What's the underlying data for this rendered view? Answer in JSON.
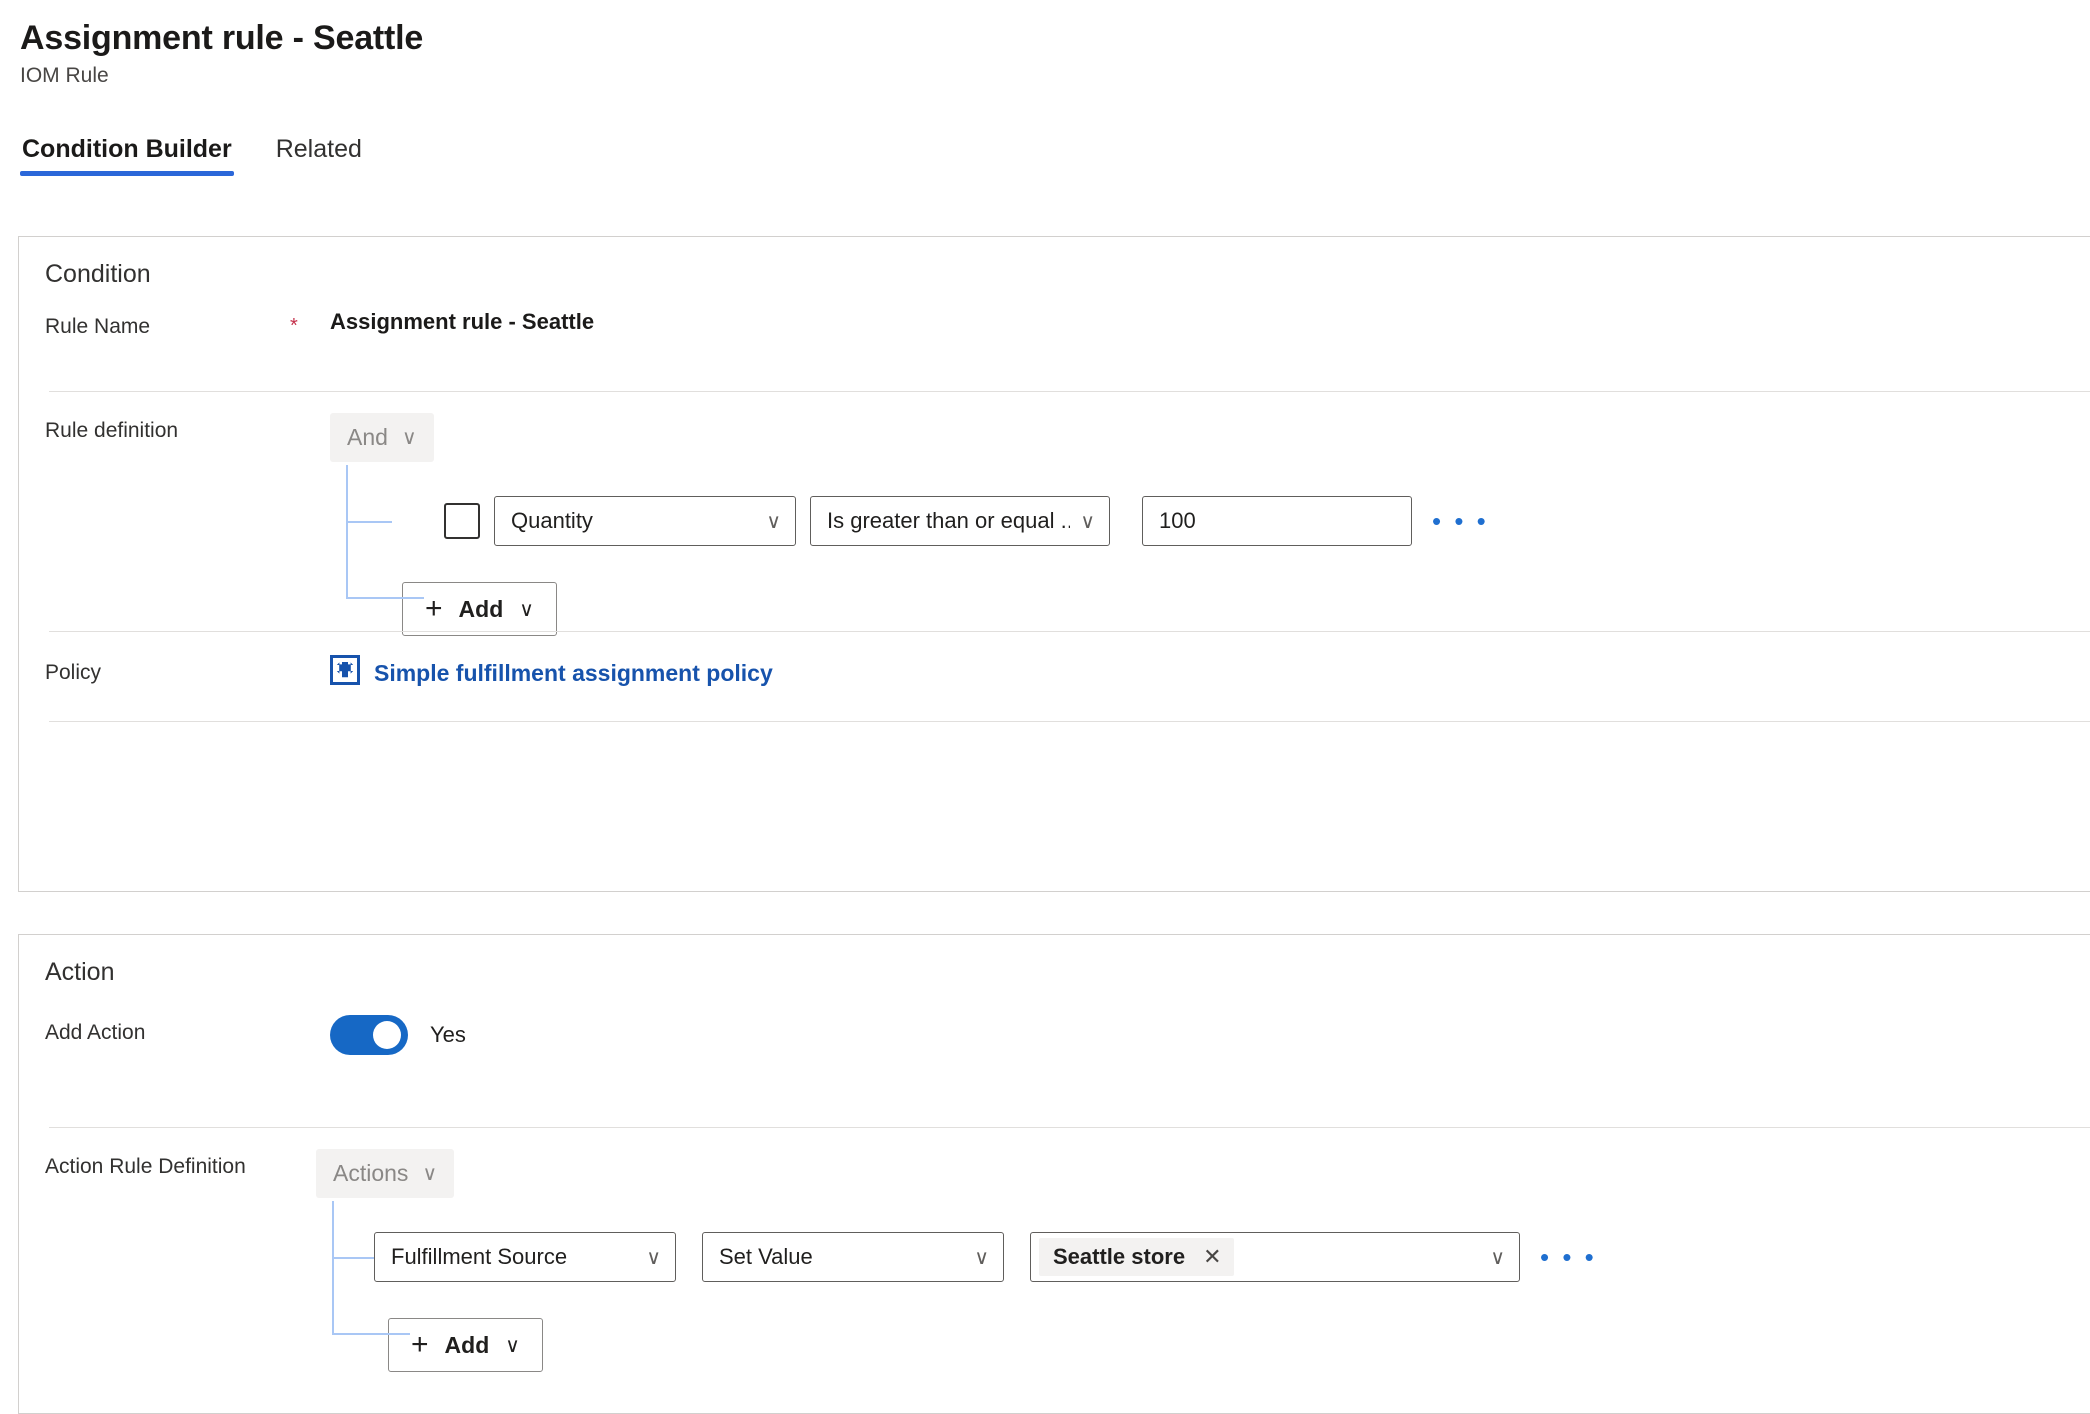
{
  "header": {
    "title": "Assignment rule - Seattle",
    "subtitle": "IOM Rule"
  },
  "tabs": [
    {
      "label": "Condition Builder",
      "selected": true
    },
    {
      "label": "Related",
      "selected": false
    }
  ],
  "condition": {
    "section_title": "Condition",
    "rule_name": {
      "label": "Rule Name",
      "required_marker": "*",
      "value": "Assignment rule - Seattle"
    },
    "rule_definition": {
      "label": "Rule definition",
      "group_operator": "And",
      "clause": {
        "attribute": "Quantity",
        "operator": "Is greater than or equal ...",
        "value": "100",
        "overflow_label": "• • •"
      },
      "add_label": "Add",
      "add_plus": "+"
    },
    "policy": {
      "label": "Policy",
      "link_text": "Simple fulfillment assignment policy"
    }
  },
  "action": {
    "section_title": "Action",
    "add_action": {
      "label": "Add Action",
      "toggle_state": "Yes"
    },
    "action_rule_definition": {
      "label": "Action Rule Definition",
      "group_operator": "Actions",
      "clause": {
        "attribute": "Fulfillment Source",
        "operator": "Set Value",
        "value_chip": "Seattle store",
        "chip_remove": "✕",
        "overflow_label": "• • •"
      },
      "add_label": "Add",
      "add_plus": "+"
    }
  },
  "icons": {
    "chevron_down": "∨"
  },
  "colors": {
    "accent": "#2b67d9",
    "link": "#1753ac",
    "toggle_on": "#1668c5",
    "required": "#c4314b",
    "tree_line": "#a9c7f5",
    "overflow_dots": "#1f6fd0"
  }
}
